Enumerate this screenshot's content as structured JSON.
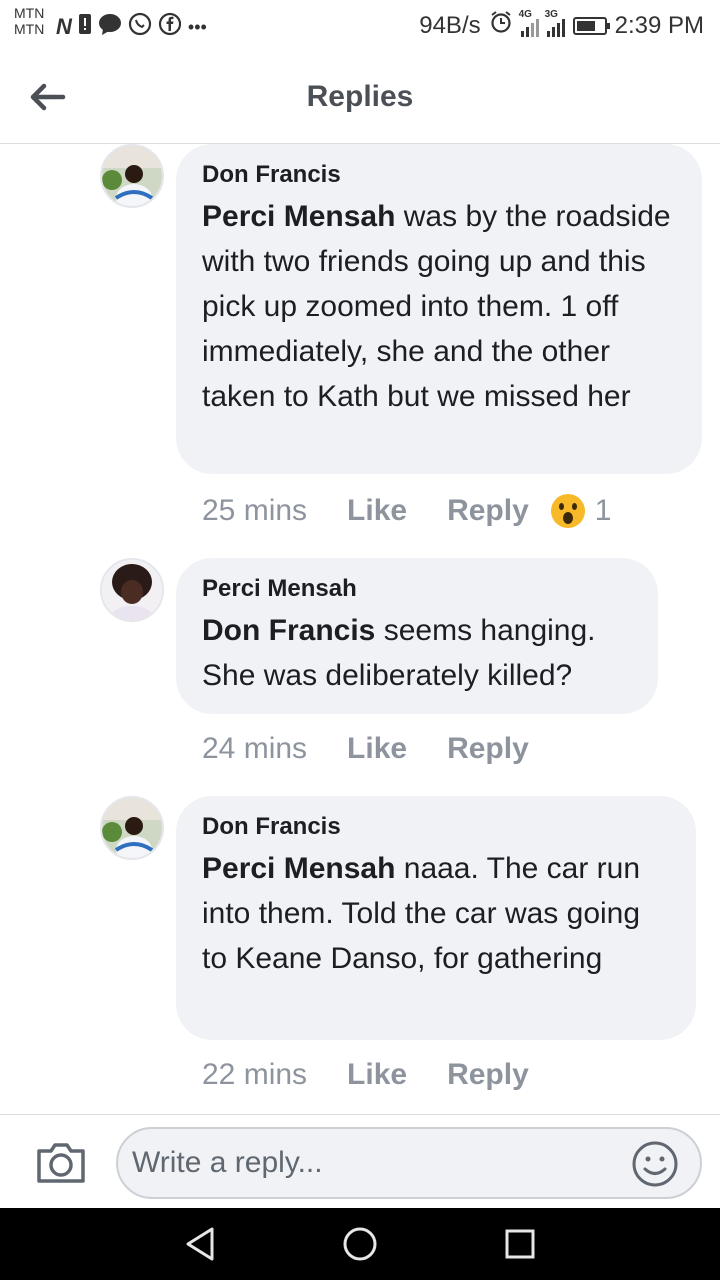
{
  "status_bar": {
    "carrier_1": "MTN",
    "carrier_2": "MTN",
    "net_speed": "94B/s",
    "signal_1_tag": "4G",
    "signal_2_tag": "3G",
    "time": "2:39 PM"
  },
  "header": {
    "title": "Replies"
  },
  "comments": [
    {
      "author": "Don Francis",
      "mention": "Perci Mensah",
      "text": " was by the roadside with two friends going up and this pick up zoomed into them. 1 off immediately, she and the other taken to Kath but we missed her",
      "time": "25 mins",
      "like_label": "Like",
      "reply_label": "Reply",
      "reaction_count": "1",
      "reaction_icon": "wow-icon"
    },
    {
      "author": "Perci Mensah",
      "mention": "Don Francis",
      "text": " seems hanging. She was deliberately killed?",
      "time": "24 mins",
      "like_label": "Like",
      "reply_label": "Reply"
    },
    {
      "author": "Don Francis",
      "mention": "Perci Mensah",
      "text": " naaa. The car run into them. Told the car was going to Keane Danso, for gathering",
      "time": "22 mins",
      "like_label": "Like",
      "reply_label": "Reply"
    }
  ],
  "composer": {
    "placeholder": "Write a reply...",
    "value": ""
  },
  "colors": {
    "bubble": "#f0f2f5",
    "meta_text": "#8d949e",
    "title_text": "#4b4f56"
  }
}
